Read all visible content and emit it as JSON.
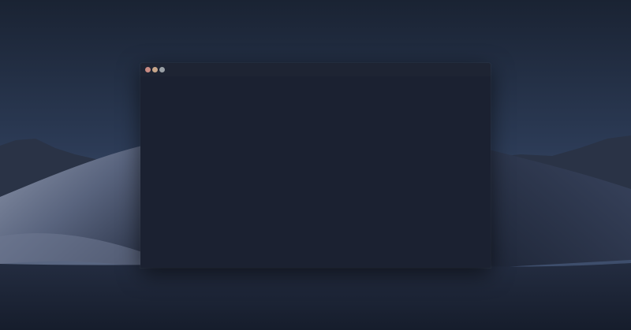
{
  "desktop": {
    "wallpaper": "mojave-night-dunes"
  },
  "window": {
    "title": "",
    "controls": {
      "close": {
        "icon": "close-icon",
        "color": "#c98b83"
      },
      "minimize": {
        "icon": "minimize-icon",
        "color": "#c7a68a"
      },
      "maximize": {
        "icon": "maximize-icon",
        "color": "#9aa0a6"
      }
    },
    "background_color": "#1b2131"
  }
}
